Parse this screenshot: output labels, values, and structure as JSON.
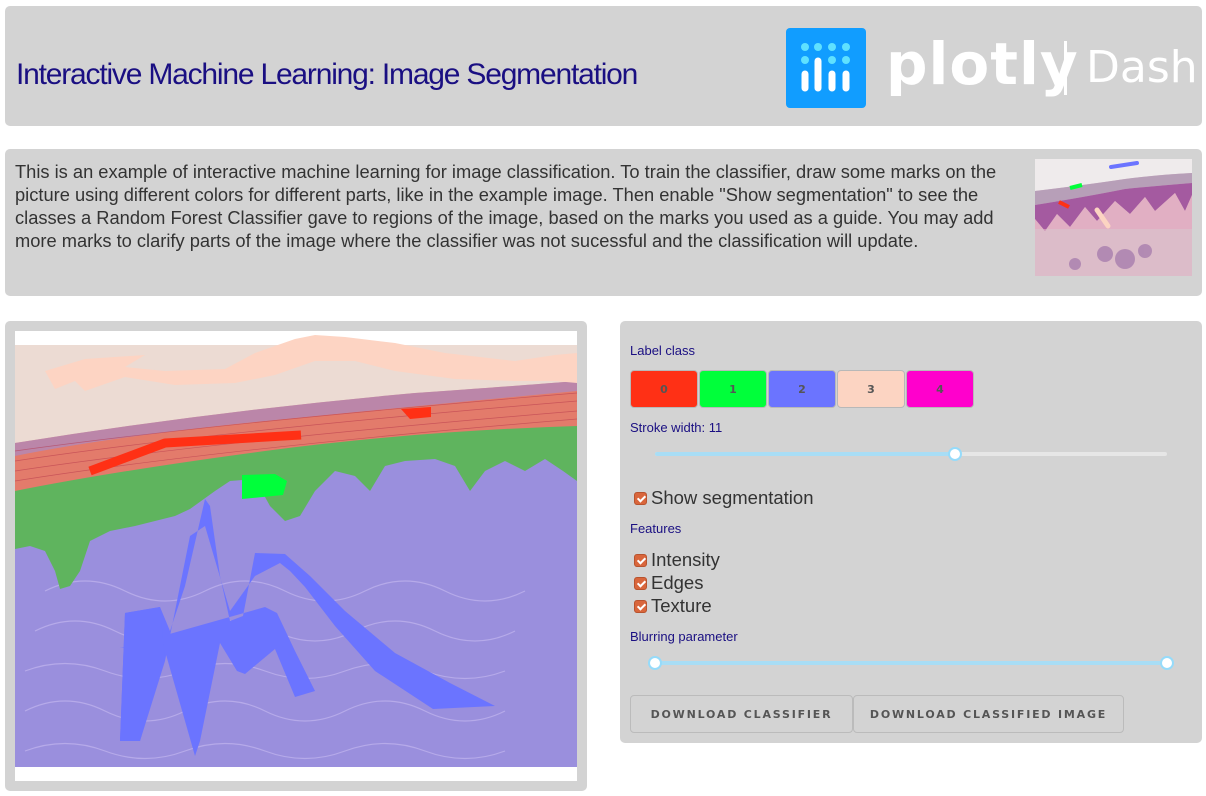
{
  "header": {
    "title": "Interactive Machine Learning: Image Segmentation",
    "logo_word": "plotly",
    "logo_product": "Dash",
    "logo_color": "#119dff"
  },
  "intro": {
    "text": "This is an example of interactive machine learning for image classification. To train the classifier, draw some marks on the picture using different colors for different parts, like in the example image. Then enable \"Show segmentation\" to see the classes a Random Forest Classifier gave to regions of the image, based on the marks you used as a guide. You may add more marks to clarify parts of the image where the classifier was not sucessful and the classification will update.",
    "example_image": "example-annotated-skin-histology-thumbnail"
  },
  "image_panel": {
    "image": "segmented-skin-histology-image-with-annotation-strokes"
  },
  "controls": {
    "label_class_title": "Label class",
    "classes": [
      {
        "label": "0",
        "color": "#ff3015"
      },
      {
        "label": "1",
        "color": "#00ff3a"
      },
      {
        "label": "2",
        "color": "#6b74ff"
      },
      {
        "label": "3",
        "color": "#fcd4c2"
      },
      {
        "label": "4",
        "color": "#ff00cc"
      }
    ],
    "stroke_width_label": "Stroke width: 11",
    "stroke_width": {
      "value": 11,
      "fraction": 0.585
    },
    "show_segmentation": {
      "label": "Show segmentation",
      "checked": true
    },
    "features_title": "Features",
    "features": [
      {
        "label": "Intensity",
        "checked": true
      },
      {
        "label": "Edges",
        "checked": true
      },
      {
        "label": "Texture",
        "checked": true
      }
    ],
    "blur_label": "Blurring parameter",
    "blur_range": {
      "low_fraction": 0.0,
      "high_fraction": 1.0
    },
    "download_classifier_label": "DOWNLOAD CLASSIFIER",
    "download_image_label": "DOWNLOAD CLASSIFIED IMAGE"
  }
}
